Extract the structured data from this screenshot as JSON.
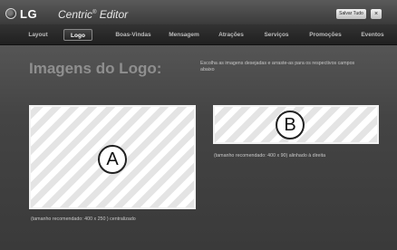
{
  "header": {
    "brand": "LG",
    "app_title": "Centric",
    "app_title_mark": "®",
    "app_title_suffix": " Editor",
    "save_label": "Salvar Tudo",
    "close_label": "×"
  },
  "tabs": [
    {
      "label": "Layout",
      "active": false
    },
    {
      "label": "Logo",
      "active": true
    },
    {
      "label": "Boas-Vindas",
      "active": false
    },
    {
      "label": "Mensagem",
      "active": false
    },
    {
      "label": "Atrações",
      "active": false
    },
    {
      "label": "Serviços",
      "active": false
    },
    {
      "label": "Promoções",
      "active": false
    },
    {
      "label": "Eventos",
      "active": false
    }
  ],
  "main": {
    "title": "Imagens do Logo:",
    "instructions": "Escolha as imagens desejadas e arraste-as para os respectivos campos abaixo",
    "slot_a": {
      "marker": "A",
      "caption": "(tamanho recomendado: 400 x 250 ) centralizado"
    },
    "slot_b": {
      "marker": "B",
      "caption": "(tamanho recomendado: 400 x 90) alinhado à direita"
    }
  },
  "colors": {
    "background": "#3a3a3a",
    "tab_bar": "#262626",
    "active_tab_border": "#888888",
    "slot_stripe": "#e4e4e4"
  },
  "icons": {
    "logo": "lg-logo-icon",
    "close": "close-icon"
  }
}
